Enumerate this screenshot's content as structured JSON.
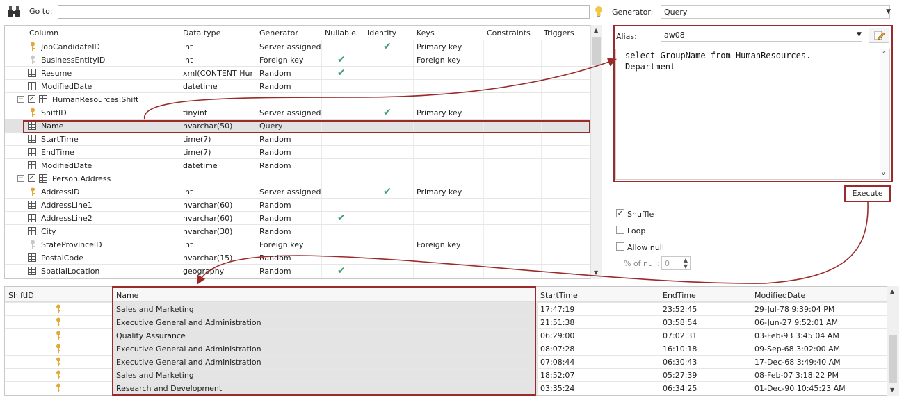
{
  "toolbar": {
    "goto_label": "Go to:",
    "goto_value": "",
    "generator_label": "Generator:",
    "generator_value": "Query"
  },
  "columns_grid": {
    "headers": [
      "Column",
      "Data type",
      "Generator",
      "Nullable",
      "Identity",
      "Keys",
      "Constraints",
      "Triggers"
    ],
    "rows": [
      {
        "kind": "col",
        "icon": "key",
        "name": "JobCandidateID",
        "type": "int",
        "gen": "Server assigned",
        "nullable": false,
        "identity": true,
        "keys": "Primary key"
      },
      {
        "kind": "col",
        "icon": "fk",
        "name": "BusinessEntityID",
        "type": "int",
        "gen": "Foreign key",
        "nullable": true,
        "identity": false,
        "keys": "Foreign key"
      },
      {
        "kind": "col",
        "icon": "col",
        "name": "Resume",
        "type": "xml(CONTENT Hum...",
        "gen": "Random",
        "nullable": true,
        "identity": false,
        "keys": ""
      },
      {
        "kind": "col",
        "icon": "col",
        "name": "ModifiedDate",
        "type": "datetime",
        "gen": "Random",
        "nullable": false,
        "identity": false,
        "keys": ""
      },
      {
        "kind": "table",
        "name": "HumanResources.Shift",
        "checked": true
      },
      {
        "kind": "col",
        "icon": "key",
        "name": "ShiftID",
        "type": "tinyint",
        "gen": "Server assigned",
        "nullable": false,
        "identity": true,
        "keys": "Primary key"
      },
      {
        "kind": "col",
        "icon": "col",
        "name": "Name",
        "type": "nvarchar(50)",
        "gen": "Query",
        "nullable": false,
        "identity": false,
        "keys": "",
        "selected": true
      },
      {
        "kind": "col",
        "icon": "col",
        "name": "StartTime",
        "type": "time(7)",
        "gen": "Random",
        "nullable": false,
        "identity": false,
        "keys": ""
      },
      {
        "kind": "col",
        "icon": "col",
        "name": "EndTime",
        "type": "time(7)",
        "gen": "Random",
        "nullable": false,
        "identity": false,
        "keys": ""
      },
      {
        "kind": "col",
        "icon": "col",
        "name": "ModifiedDate",
        "type": "datetime",
        "gen": "Random",
        "nullable": false,
        "identity": false,
        "keys": ""
      },
      {
        "kind": "table",
        "name": "Person.Address",
        "checked": true
      },
      {
        "kind": "col",
        "icon": "key",
        "name": "AddressID",
        "type": "int",
        "gen": "Server assigned",
        "nullable": false,
        "identity": true,
        "keys": "Primary key"
      },
      {
        "kind": "col",
        "icon": "col",
        "name": "AddressLine1",
        "type": "nvarchar(60)",
        "gen": "Random",
        "nullable": false,
        "identity": false,
        "keys": ""
      },
      {
        "kind": "col",
        "icon": "col",
        "name": "AddressLine2",
        "type": "nvarchar(60)",
        "gen": "Random",
        "nullable": true,
        "identity": false,
        "keys": ""
      },
      {
        "kind": "col",
        "icon": "col",
        "name": "City",
        "type": "nvarchar(30)",
        "gen": "Random",
        "nullable": false,
        "identity": false,
        "keys": ""
      },
      {
        "kind": "col",
        "icon": "fk",
        "name": "StateProvinceID",
        "type": "int",
        "gen": "Foreign key",
        "nullable": false,
        "identity": false,
        "keys": "Foreign key"
      },
      {
        "kind": "col",
        "icon": "col",
        "name": "PostalCode",
        "type": "nvarchar(15)",
        "gen": "Random",
        "nullable": false,
        "identity": false,
        "keys": ""
      },
      {
        "kind": "col",
        "icon": "col",
        "name": "SpatialLocation",
        "type": "geography",
        "gen": "Random",
        "nullable": true,
        "identity": false,
        "keys": ""
      }
    ]
  },
  "query_panel": {
    "alias_label": "Alias:",
    "alias_value": "aw08",
    "sql": "select GroupName from HumanResources.\nDepartment",
    "execute_label": "Execute"
  },
  "options": {
    "shuffle_label": "Shuffle",
    "shuffle_checked": true,
    "loop_label": "Loop",
    "loop_checked": false,
    "allow_null_label": "Allow null",
    "allow_null_checked": false,
    "pct_null_label": "% of null:",
    "pct_null_value": "0"
  },
  "results": {
    "headers": [
      "ShiftID",
      "Name",
      "StartTime",
      "EndTime",
      "ModifiedDate"
    ],
    "rows": [
      {
        "name": "Sales and Marketing",
        "start": "17:47:19",
        "end": "23:52:45",
        "modified": "29-Jul-78 9:39:04 PM"
      },
      {
        "name": "Executive General and Administration",
        "start": "21:51:38",
        "end": "03:58:54",
        "modified": "06-Jun-27 9:52:01 AM"
      },
      {
        "name": "Quality Assurance",
        "start": "06:29:00",
        "end": "07:02:31",
        "modified": "03-Feb-93 3:45:04 AM"
      },
      {
        "name": "Executive General and Administration",
        "start": "08:07:28",
        "end": "16:10:18",
        "modified": "09-Sep-68 3:02:00 AM"
      },
      {
        "name": "Executive General and Administration",
        "start": "07:08:44",
        "end": "06:30:43",
        "modified": "17-Dec-68 3:49:40 AM"
      },
      {
        "name": "Sales and Marketing",
        "start": "18:52:07",
        "end": "05:27:39",
        "modified": "08-Feb-07 3:18:22 PM"
      },
      {
        "name": "Research and Development",
        "start": "03:35:24",
        "end": "06:34:25",
        "modified": "01-Dec-90 10:45:23 AM"
      }
    ]
  },
  "colors": {
    "highlight": "#9b2b2b",
    "check": "#3a9a6a",
    "key": "#e2a93a"
  }
}
